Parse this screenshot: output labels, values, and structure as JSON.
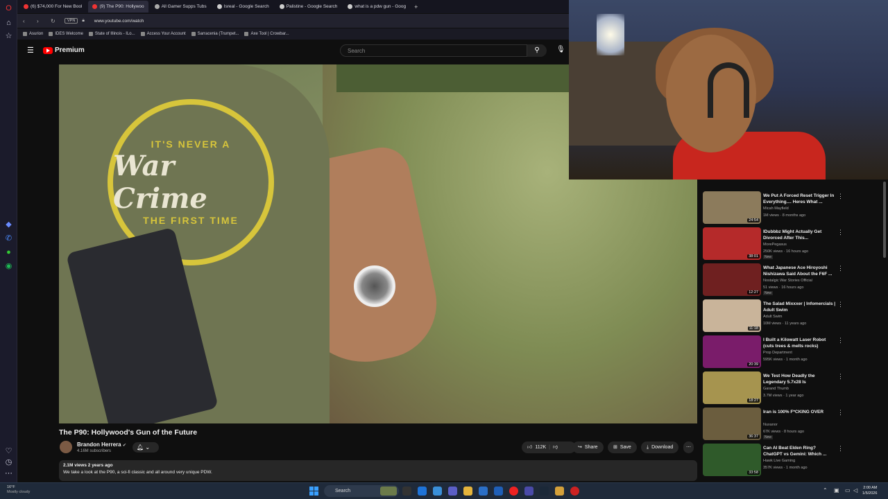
{
  "browser": {
    "tabs": [
      {
        "label": "(6) $74,000 For New Bool",
        "active": false,
        "color": "#e33"
      },
      {
        "label": "(9) The P90: Hollywoo",
        "active": true,
        "color": "#e33"
      },
      {
        "label": "All Gamer Supps Tubs",
        "active": false,
        "color": "#aaa"
      },
      {
        "label": "Isreal - Google Search",
        "active": false,
        "color": "#ccc"
      },
      {
        "label": "Palistine - Google Search",
        "active": false,
        "color": "#ccc"
      },
      {
        "label": "what is a pdw gun - Goog",
        "active": false,
        "color": "#ccc"
      }
    ],
    "new_tab": "+",
    "vpn": "VPN",
    "url": "www.youtube.com/watch",
    "bookmarks": [
      "Asurion",
      "IDES Welcome",
      "State of Illinois - ILo...",
      "Access Your Account",
      "Sarracenia (Trumpet...",
      "Axe Tool | Crowbar..."
    ]
  },
  "youtube": {
    "brand": "Premium",
    "search_placeholder": "Search",
    "video": {
      "title": "The P90: Hollywood's Gun of the Future",
      "channel": "Brandon Herrera",
      "subscribers": "4.16M subscribers",
      "likes": "112K",
      "share": "Share",
      "save": "Save",
      "download": "Download",
      "views_age": "2.1M views  2 years ago",
      "description": "We take a look at the P90, a sci-fi classic and all around very unique PDW.",
      "shirt_top": "IT'S NEVER A",
      "shirt_main": "War Crime",
      "shirt_bottom": "THE FIRST TIME"
    },
    "recommendations": [
      {
        "title": "We Put A Forced Reset Trigger In Everything.... Heres What ...",
        "channel": "Micah Mayfield",
        "meta": "1M views · 8 months ago",
        "duration": "24:54",
        "new": "",
        "thumb": "#8c7b5c"
      },
      {
        "title": "IDubbbz Might Actually Get Divorced After This...",
        "channel": "MorePegasus",
        "meta": "250K views · 16 hours ago",
        "duration": "38:01",
        "new": "New",
        "thumb": "#b52a2a"
      },
      {
        "title": "What Japanese Ace Hiroyoshi Nishizawa Said About the F6F ...",
        "channel": "Nostalgic War Stories Official",
        "meta": "51 views · 16 hours ago",
        "duration": "12:27",
        "new": "New",
        "thumb": "#6f2020"
      },
      {
        "title": "The Salad Mixxxer | Infomercials | Adult Swim",
        "channel": "Adult Swim",
        "meta": "10M views · 11 years ago",
        "duration": "11:18",
        "new": "",
        "thumb": "#c9b49a"
      },
      {
        "title": "I Built a Kilowatt Laser Robot (cuts trees & melts rocks)",
        "channel": "Prop Department",
        "meta": "595K views · 1 month ago",
        "duration": "20:39",
        "new": "",
        "thumb": "#7a1c6a"
      },
      {
        "title": "We Test How Deadly the Legendary 5.7x28 Is",
        "channel": "Garand Thumb",
        "meta": "3.7M views · 1 year ago",
        "duration": "18:27",
        "new": "",
        "thumb": "#a6944f"
      },
      {
        "title": "Iran is 100% F*CKING OVER",
        "channel": "Nuxanor",
        "meta": "67K views · 8 hours ago",
        "duration": "36:37",
        "new": "New",
        "thumb": "#6b5d3e"
      },
      {
        "title": "Can AI Beat Elden Ring? ChatGPT vs Gemini: Which ...",
        "channel": "Hawk Live Gaming",
        "meta": "357K views · 1 month ago",
        "duration": "33:58",
        "new": "",
        "thumb": "#2f5a2a"
      }
    ]
  },
  "taskbar": {
    "weather_temp": "16°F",
    "weather_desc": "Mostly cloudy",
    "search": "Search",
    "time": "2:00 AM",
    "date": "1/5/2026"
  }
}
